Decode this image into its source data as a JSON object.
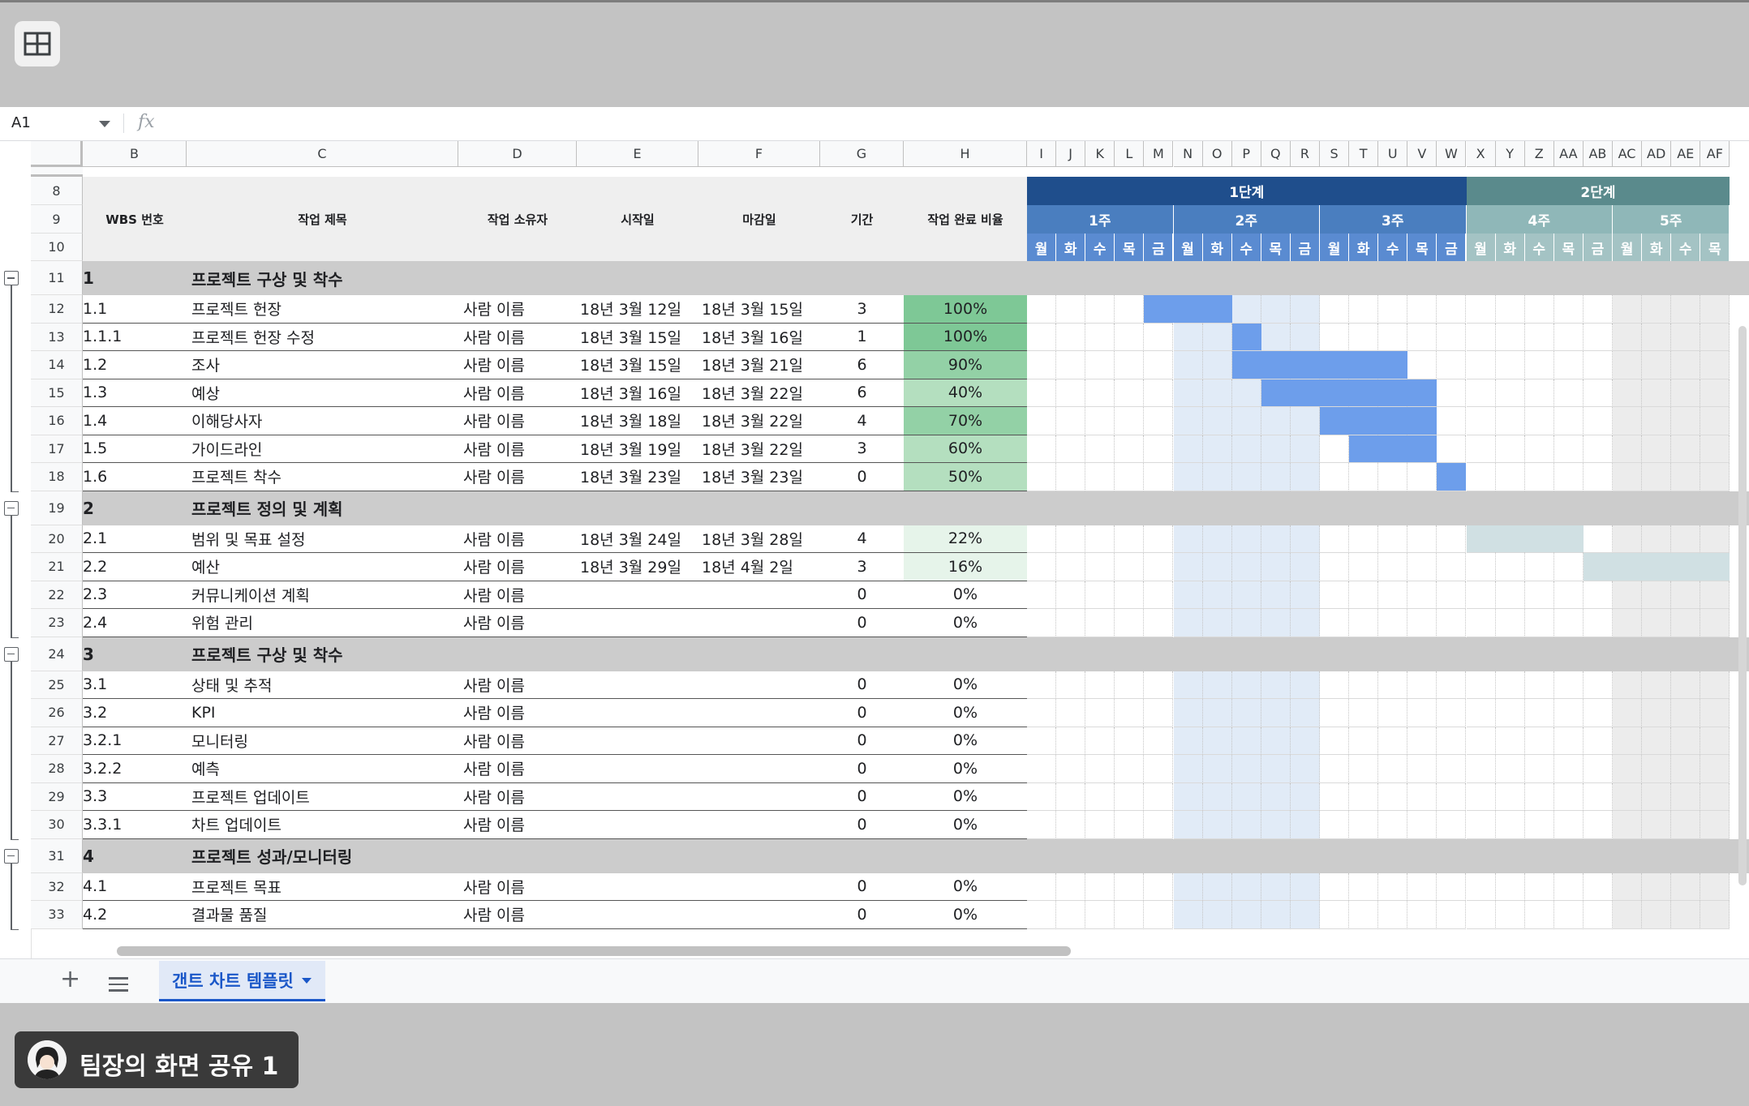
{
  "formula_bar": {
    "cell_ref": "A1",
    "fx": "fx"
  },
  "columns": {
    "letters": [
      "B",
      "C",
      "D",
      "E",
      "F",
      "G",
      "H"
    ],
    "grid_letters": [
      "I",
      "J",
      "K",
      "L",
      "M",
      "N",
      "O",
      "P",
      "Q",
      "R",
      "S",
      "T",
      "U",
      "V",
      "W",
      "X",
      "Y",
      "Z",
      "AA",
      "AB",
      "AC",
      "AD",
      "AE",
      "AF"
    ]
  },
  "header": {
    "row_numbers": [
      "8",
      "9",
      "10"
    ],
    "wbs": "WBS 번호",
    "title": "작업 제목",
    "owner": "작업 소유자",
    "start": "시작일",
    "end": "마감일",
    "duration": "기간",
    "percent": "작업 완료 비율",
    "phase1": "1단계",
    "phase2": "2단계",
    "weeks": [
      "1주",
      "2주",
      "3주",
      "4주",
      "5주"
    ],
    "days": [
      "월",
      "화",
      "수",
      "목",
      "금",
      "월",
      "화",
      "수",
      "목",
      "금",
      "월",
      "화",
      "수",
      "목",
      "금",
      "월",
      "화",
      "수",
      "목",
      "금",
      "월",
      "화",
      "수",
      "목"
    ]
  },
  "rows": [
    {
      "n": "11",
      "type": "section",
      "wbs": "1",
      "title": "프로젝트 구상 및 착수"
    },
    {
      "n": "12",
      "type": "task",
      "wbs": "1.1",
      "title": "프로젝트 헌장",
      "owner": "사람 이름",
      "start": "18년 3월 12일",
      "end": "18년 3월 15일",
      "dur": "3",
      "pct": "100%"
    },
    {
      "n": "13",
      "type": "task",
      "wbs": "1.1.1",
      "title": "프로젝트 헌장 수정",
      "owner": "사람 이름",
      "start": "18년 3월 15일",
      "end": "18년 3월 16일",
      "dur": "1",
      "pct": "100%"
    },
    {
      "n": "14",
      "type": "task",
      "wbs": "1.2",
      "title": "조사",
      "owner": "사람 이름",
      "start": "18년 3월 15일",
      "end": "18년 3월 21일",
      "dur": "6",
      "pct": "90%"
    },
    {
      "n": "15",
      "type": "task",
      "wbs": "1.3",
      "title": "예상",
      "owner": "사람 이름",
      "start": "18년 3월 16일",
      "end": "18년 3월 22일",
      "dur": "6",
      "pct": "40%"
    },
    {
      "n": "16",
      "type": "task",
      "wbs": "1.4",
      "title": "이해당사자",
      "owner": "사람 이름",
      "start": "18년 3월 18일",
      "end": "18년 3월 22일",
      "dur": "4",
      "pct": "70%"
    },
    {
      "n": "17",
      "type": "task",
      "wbs": "1.5",
      "title": "가이드라인",
      "owner": "사람 이름",
      "start": "18년 3월 19일",
      "end": "18년 3월 22일",
      "dur": "3",
      "pct": "60%"
    },
    {
      "n": "18",
      "type": "task",
      "wbs": "1.6",
      "title": "프로젝트 착수",
      "owner": "사람 이름",
      "start": "18년 3월 23일",
      "end": "18년 3월 23일",
      "dur": "0",
      "pct": "50%"
    },
    {
      "n": "19",
      "type": "section",
      "wbs": "2",
      "title": "프로젝트 정의 및 계획"
    },
    {
      "n": "20",
      "type": "task",
      "wbs": "2.1",
      "title": "범위 및 목표 설정",
      "owner": "사람 이름",
      "start": "18년 3월 24일",
      "end": "18년 3월 28일",
      "dur": "4",
      "pct": "22%"
    },
    {
      "n": "21",
      "type": "task",
      "wbs": "2.2",
      "title": "예산",
      "owner": "사람 이름",
      "start": "18년 3월 29일",
      "end": "18년 4월 2일",
      "dur": "3",
      "pct": "16%"
    },
    {
      "n": "22",
      "type": "task",
      "wbs": "2.3",
      "title": "커뮤니케이션 계획",
      "owner": "사람 이름",
      "start": "",
      "end": "",
      "dur": "0",
      "pct": "0%"
    },
    {
      "n": "23",
      "type": "task",
      "wbs": "2.4",
      "title": "위험 관리",
      "owner": "사람 이름",
      "start": "",
      "end": "",
      "dur": "0",
      "pct": "0%"
    },
    {
      "n": "24",
      "type": "section",
      "wbs": "3",
      "title": "프로젝트 구상 및 착수"
    },
    {
      "n": "25",
      "type": "task",
      "wbs": "3.1",
      "title": "상태 및 추적",
      "owner": "사람 이름",
      "start": "",
      "end": "",
      "dur": "0",
      "pct": "0%"
    },
    {
      "n": "26",
      "type": "task",
      "wbs": "3.2",
      "title": "KPI",
      "owner": "사람 이름",
      "start": "",
      "end": "",
      "dur": "0",
      "pct": "0%"
    },
    {
      "n": "27",
      "type": "task",
      "wbs": "3.2.1",
      "title": "모니터링",
      "owner": "사람 이름",
      "start": "",
      "end": "",
      "dur": "0",
      "pct": "0%"
    },
    {
      "n": "28",
      "type": "task",
      "wbs": "3.2.2",
      "title": "예측",
      "owner": "사람 이름",
      "start": "",
      "end": "",
      "dur": "0",
      "pct": "0%"
    },
    {
      "n": "29",
      "type": "task",
      "wbs": "3.3",
      "title": "프로젝트 업데이트",
      "owner": "사람 이름",
      "start": "",
      "end": "",
      "dur": "0",
      "pct": "0%"
    },
    {
      "n": "30",
      "type": "task",
      "wbs": "3.3.1",
      "title": "차트 업데이트",
      "owner": "사람 이름",
      "start": "",
      "end": "",
      "dur": "0",
      "pct": "0%"
    },
    {
      "n": "31",
      "type": "section",
      "wbs": "4",
      "title": "프로젝트 성과/모니터링"
    },
    {
      "n": "32",
      "type": "task",
      "wbs": "4.1",
      "title": "프로젝트 목표",
      "owner": "사람 이름",
      "start": "",
      "end": "",
      "dur": "0",
      "pct": "0%"
    },
    {
      "n": "33",
      "type": "task",
      "wbs": "4.2",
      "title": "결과물 품질",
      "owner": "사람 이름",
      "start": "",
      "end": "",
      "dur": "0",
      "pct": "0%"
    }
  ],
  "gantt_bars": [
    {
      "row": "12",
      "from": 4,
      "to": 6,
      "color": "#6d9eeb"
    },
    {
      "row": "13",
      "from": 7,
      "to": 7,
      "color": "#6d9eeb"
    },
    {
      "row": "14",
      "from": 7,
      "to": 12,
      "color": "#6d9eeb"
    },
    {
      "row": "15",
      "from": 8,
      "to": 13,
      "color": "#6d9eeb"
    },
    {
      "row": "16",
      "from": 10,
      "to": 13,
      "color": "#6d9eeb"
    },
    {
      "row": "17",
      "from": 11,
      "to": 13,
      "color": "#6d9eeb"
    },
    {
      "row": "18",
      "from": 14,
      "to": 14,
      "color": "#6d9eeb"
    },
    {
      "row": "20",
      "from": 15,
      "to": 18,
      "color": "#d0e0e3"
    },
    {
      "row": "21",
      "from": 19,
      "to": 23,
      "color": "#d0e0e3"
    }
  ],
  "colors": {
    "phase1": "#1f4e8c",
    "phase2": "#5a8a8c",
    "week_phase1": "#4a7ebf",
    "week_phase2": "#8fb7b8",
    "day_phase1": "#5a8bd1",
    "day_phase2": "#a4c3c4",
    "shade_week2": "#e1ebf7",
    "shade_week5": "#ececec",
    "pct_100": "#7ec896",
    "pct_high": "#93d1a6",
    "pct_mid": "#b4dfbf",
    "pct_low": "#e6f4ea",
    "active_tab": "#1a57c8"
  },
  "tabs": {
    "add": "+",
    "active": "갠트 차트 템플릿"
  },
  "share": {
    "label": "팀장의 화면 공유 1"
  }
}
